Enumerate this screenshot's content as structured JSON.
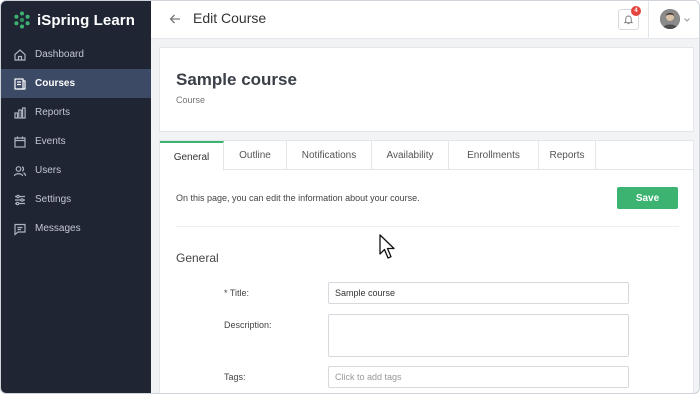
{
  "app": {
    "brand_name": "iSpring Learn",
    "accent_color": "#3cb371",
    "sidebar_color": "#1f2533"
  },
  "sidebar": {
    "items": [
      {
        "label": "Dashboard",
        "icon": "home-icon",
        "active": false
      },
      {
        "label": "Courses",
        "icon": "courses-icon",
        "active": true
      },
      {
        "label": "Reports",
        "icon": "bar-chart-icon",
        "active": false
      },
      {
        "label": "Events",
        "icon": "calendar-icon",
        "active": false
      },
      {
        "label": "Users",
        "icon": "users-icon",
        "active": false
      },
      {
        "label": "Settings",
        "icon": "sliders-icon",
        "active": false
      },
      {
        "label": "Messages",
        "icon": "message-icon",
        "active": false
      }
    ]
  },
  "header": {
    "title": "Edit Course",
    "notification_count": "4"
  },
  "course": {
    "title": "Sample course",
    "subtitle": "Course"
  },
  "tabs": [
    {
      "label": "General",
      "active": true
    },
    {
      "label": "Outline",
      "active": false
    },
    {
      "label": "Notifications",
      "active": false
    },
    {
      "label": "Availability",
      "active": false
    },
    {
      "label": "Enrollments",
      "active": false
    },
    {
      "label": "Reports",
      "active": false
    }
  ],
  "main": {
    "info_text": "On this page, you can edit the information about your course.",
    "save_label": "Save",
    "section_title": "General"
  },
  "form": {
    "title_label": "* Title:",
    "title_value": "Sample course",
    "description_label": "Description:",
    "description_value": "",
    "tags_label": "Tags:",
    "tags_placeholder": "Click to add tags"
  }
}
